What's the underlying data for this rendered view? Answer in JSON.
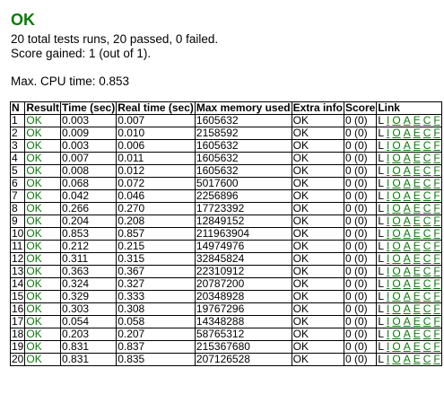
{
  "header": {
    "status": "OK",
    "summary_line": "20 total tests runs, 20 passed, 0 failed.",
    "score_line": "Score gained: 1 (out of 1).",
    "cpu_line": "Max. CPU time: 0.853"
  },
  "colors": {
    "ok_green": "#0a7a0a",
    "border": "#000000"
  },
  "table": {
    "headers": [
      "N",
      "Result",
      "Time (sec)",
      "Real time (sec)",
      "Max memory used",
      "Extra info",
      "Score",
      "Link"
    ],
    "link_labels": [
      "L",
      "I",
      "O",
      "A",
      "E",
      "C",
      "F"
    ],
    "rows": [
      {
        "n": "1",
        "result": "OK",
        "time": "0.003",
        "real": "0.007",
        "mem": "1605632",
        "extra": "OK",
        "score": "0 (0)"
      },
      {
        "n": "2",
        "result": "OK",
        "time": "0.009",
        "real": "0.010",
        "mem": "2158592",
        "extra": "OK",
        "score": "0 (0)"
      },
      {
        "n": "3",
        "result": "OK",
        "time": "0.003",
        "real": "0.006",
        "mem": "1605632",
        "extra": "OK",
        "score": "0 (0)"
      },
      {
        "n": "4",
        "result": "OK",
        "time": "0.007",
        "real": "0.011",
        "mem": "1605632",
        "extra": "OK",
        "score": "0 (0)"
      },
      {
        "n": "5",
        "result": "OK",
        "time": "0.008",
        "real": "0.012",
        "mem": "1605632",
        "extra": "OK",
        "score": "0 (0)"
      },
      {
        "n": "6",
        "result": "OK",
        "time": "0.068",
        "real": "0.072",
        "mem": "5017600",
        "extra": "OK",
        "score": "0 (0)"
      },
      {
        "n": "7",
        "result": "OK",
        "time": "0.042",
        "real": "0.046",
        "mem": "2256896",
        "extra": "OK",
        "score": "0 (0)"
      },
      {
        "n": "8",
        "result": "OK",
        "time": "0.266",
        "real": "0.270",
        "mem": "17723392",
        "extra": "OK",
        "score": "0 (0)"
      },
      {
        "n": "9",
        "result": "OK",
        "time": "0.204",
        "real": "0.208",
        "mem": "12849152",
        "extra": "OK",
        "score": "0 (0)"
      },
      {
        "n": "10",
        "result": "OK",
        "time": "0.853",
        "real": "0.857",
        "mem": "211963904",
        "extra": "OK",
        "score": "0 (0)"
      },
      {
        "n": "11",
        "result": "OK",
        "time": "0.212",
        "real": "0.215",
        "mem": "14974976",
        "extra": "OK",
        "score": "0 (0)"
      },
      {
        "n": "12",
        "result": "OK",
        "time": "0.311",
        "real": "0.315",
        "mem": "32845824",
        "extra": "OK",
        "score": "0 (0)"
      },
      {
        "n": "13",
        "result": "OK",
        "time": "0.363",
        "real": "0.367",
        "mem": "22310912",
        "extra": "OK",
        "score": "0 (0)"
      },
      {
        "n": "14",
        "result": "OK",
        "time": "0.324",
        "real": "0.327",
        "mem": "20787200",
        "extra": "OK",
        "score": "0 (0)"
      },
      {
        "n": "15",
        "result": "OK",
        "time": "0.329",
        "real": "0.333",
        "mem": "20348928",
        "extra": "OK",
        "score": "0 (0)"
      },
      {
        "n": "16",
        "result": "OK",
        "time": "0.303",
        "real": "0.308",
        "mem": "19767296",
        "extra": "OK",
        "score": "0 (0)"
      },
      {
        "n": "17",
        "result": "OK",
        "time": "0.054",
        "real": "0.058",
        "mem": "14348288",
        "extra": "OK",
        "score": "0 (0)"
      },
      {
        "n": "18",
        "result": "OK",
        "time": "0.203",
        "real": "0.207",
        "mem": "58765312",
        "extra": "OK",
        "score": "0 (0)"
      },
      {
        "n": "19",
        "result": "OK",
        "time": "0.831",
        "real": "0.837",
        "mem": "215367680",
        "extra": "OK",
        "score": "0 (0)"
      },
      {
        "n": "20",
        "result": "OK",
        "time": "0.831",
        "real": "0.835",
        "mem": "207126528",
        "extra": "OK",
        "score": "0 (0)"
      }
    ]
  }
}
